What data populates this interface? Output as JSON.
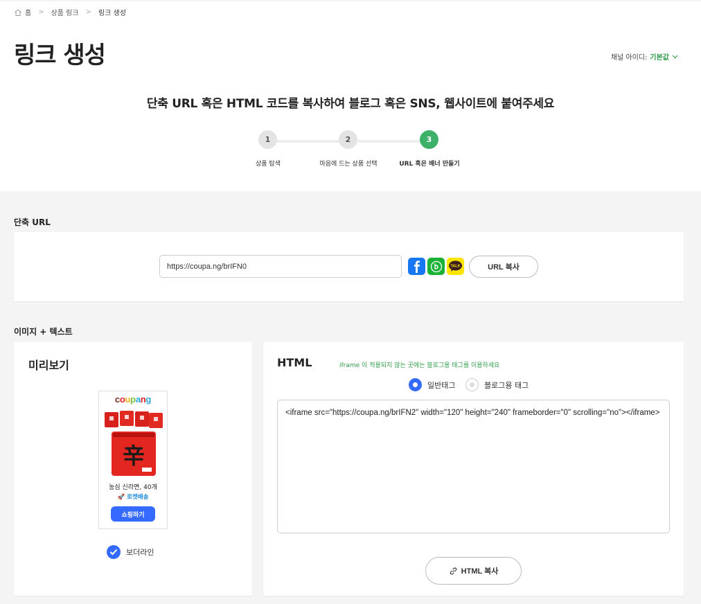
{
  "breadcrumb": {
    "home": "홈",
    "level1": "상품 링크",
    "level2": "링크 생성"
  },
  "page_title": "링크 생성",
  "channel": {
    "label": "채널 아이디:",
    "value": "기본값"
  },
  "subtitle": "단축 URL 혹은 HTML 코드를 복사하여 블로그 혹은 SNS, 웹사이트에 붙여주세요",
  "steps": [
    {
      "num": "1",
      "label": "상품 탐색"
    },
    {
      "num": "2",
      "label": "마음에 드는 상품 선택"
    },
    {
      "num": "3",
      "label": "URL 혹은 배너 만들기"
    }
  ],
  "short_url": {
    "section_label": "단축 URL",
    "url": "https://coupa.ng/brIFN0",
    "copy_button": "URL 복사",
    "share_icons": [
      "facebook-icon",
      "band-icon",
      "kakaotalk-icon"
    ],
    "kakao_text": "TALK"
  },
  "image_text": {
    "section_label": "이미지 + 텍스트",
    "preview": {
      "title": "미리보기",
      "logo": "coupang",
      "product_name": "농심 신라면, 40개",
      "rocket": "🚀 로켓배송",
      "shop_button": "쇼핑하기",
      "border_option": "보더라인"
    },
    "html": {
      "title": "HTML",
      "hint": "iframe 이 적용되지 않는 곳에는 블로그용 태그를 이용하세요",
      "radio_general": "일반태그",
      "radio_blog": "블로그용 태그",
      "code": "<iframe src=\"https://coupa.ng/brIFN2\" width=\"120\" height=\"240\" frameborder=\"0\" scrolling=\"no\"></iframe>",
      "copy_button": "HTML 복사"
    }
  },
  "colors": {
    "accent_green": "#3db06a",
    "accent_blue": "#346aff",
    "hint_green": "#2f9c4a"
  }
}
